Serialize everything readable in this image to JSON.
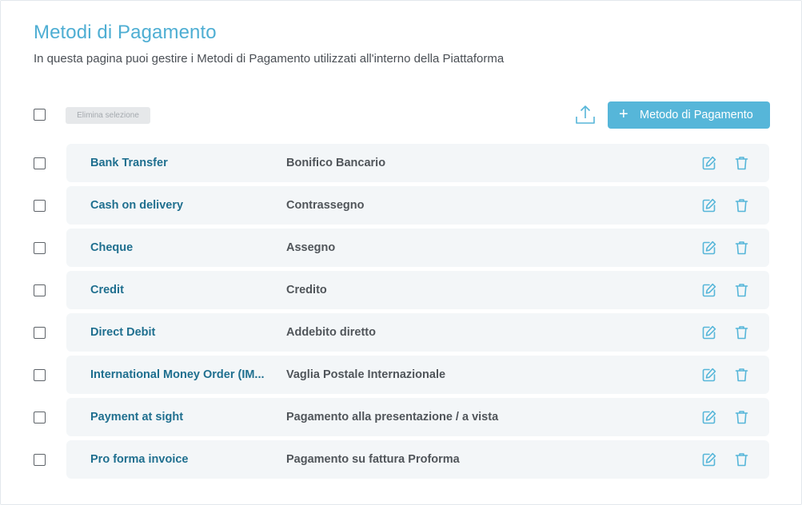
{
  "header": {
    "title": "Metodi di Pagamento",
    "subtitle": "In questa pagina puoi gestire i Metodi di Pagamento utilizzati all'interno della Piattaforma"
  },
  "toolbar": {
    "bulk_delete_label": "Elimina selezione",
    "add_button_label": "Metodo di Pagamento",
    "add_icon": "plus-icon",
    "upload_icon": "upload-icon"
  },
  "icons": {
    "edit": "edit-icon",
    "delete": "trash-icon"
  },
  "colors": {
    "title": "#4eaed3",
    "accent": "#56b6d9",
    "name_text": "#1f6f8f",
    "row_background": "#f3f6f8"
  },
  "rows": [
    {
      "name": "Bank Transfer",
      "description": "Bonifico Bancario"
    },
    {
      "name": "Cash on delivery",
      "description": "Contrassegno"
    },
    {
      "name": "Cheque",
      "description": "Assegno"
    },
    {
      "name": "Credit",
      "description": "Credito"
    },
    {
      "name": "Direct Debit",
      "description": "Addebito diretto"
    },
    {
      "name": "International Money Order (IM...",
      "description": "Vaglia Postale Internazionale"
    },
    {
      "name": "Payment at sight",
      "description": "Pagamento alla presentazione / a vista"
    },
    {
      "name": "Pro forma invoice",
      "description": "Pagamento su fattura Proforma"
    }
  ]
}
